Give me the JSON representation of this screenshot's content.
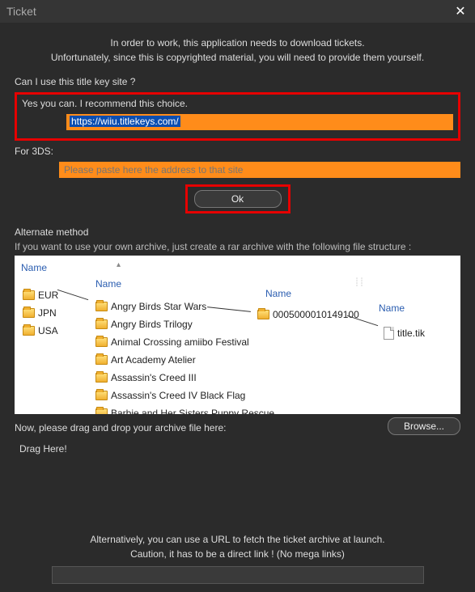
{
  "window": {
    "title": "Ticket",
    "close_glyph": "✕"
  },
  "intro": {
    "line1": "In order to work, this application needs to download tickets.",
    "line2": "Unfortunately, since this is copyrighted material, you will need to provide them yourself."
  },
  "titlekey": {
    "question": "Can I use this title key site ?",
    "recommendation": "Yes you can. I recommend this choice.",
    "wiiu_url": "https://wiiu.titlekeys.com/",
    "label_3ds": "For 3DS:",
    "placeholder_3ds": "Please paste here the address to that site",
    "ok_label": "Ok"
  },
  "alternate": {
    "heading": "Alternate method",
    "description": "If you want to use your own archive, just create a rar archive with the following file structure :",
    "headers": {
      "h1": "Name",
      "h2": "Name",
      "h3": "Name",
      "h4": "Name"
    },
    "regions": [
      "EUR",
      "JPN",
      "USA"
    ],
    "games": [
      "Angry Birds Star Wars",
      "Angry Birds Trilogy",
      "Animal Crossing amiibo Festival",
      "Art Academy Atelier",
      "Assassin's Creed III",
      "Assassin's Creed IV Black Flag",
      "Barbie and Her Sisters Puppy Rescue"
    ],
    "title_id": "0005000010149100",
    "ticket_file": "title.tik"
  },
  "dragdrop": {
    "label": "Now, please drag and drop your archive file here:",
    "drag_here": "Drag Here!",
    "browse_label": "Browse..."
  },
  "url_fetch": {
    "line1": "Alternatively, you can use a URL to fetch the ticket archive at launch.",
    "line2": "Caution, it has to be a direct link ! (No mega links)"
  }
}
